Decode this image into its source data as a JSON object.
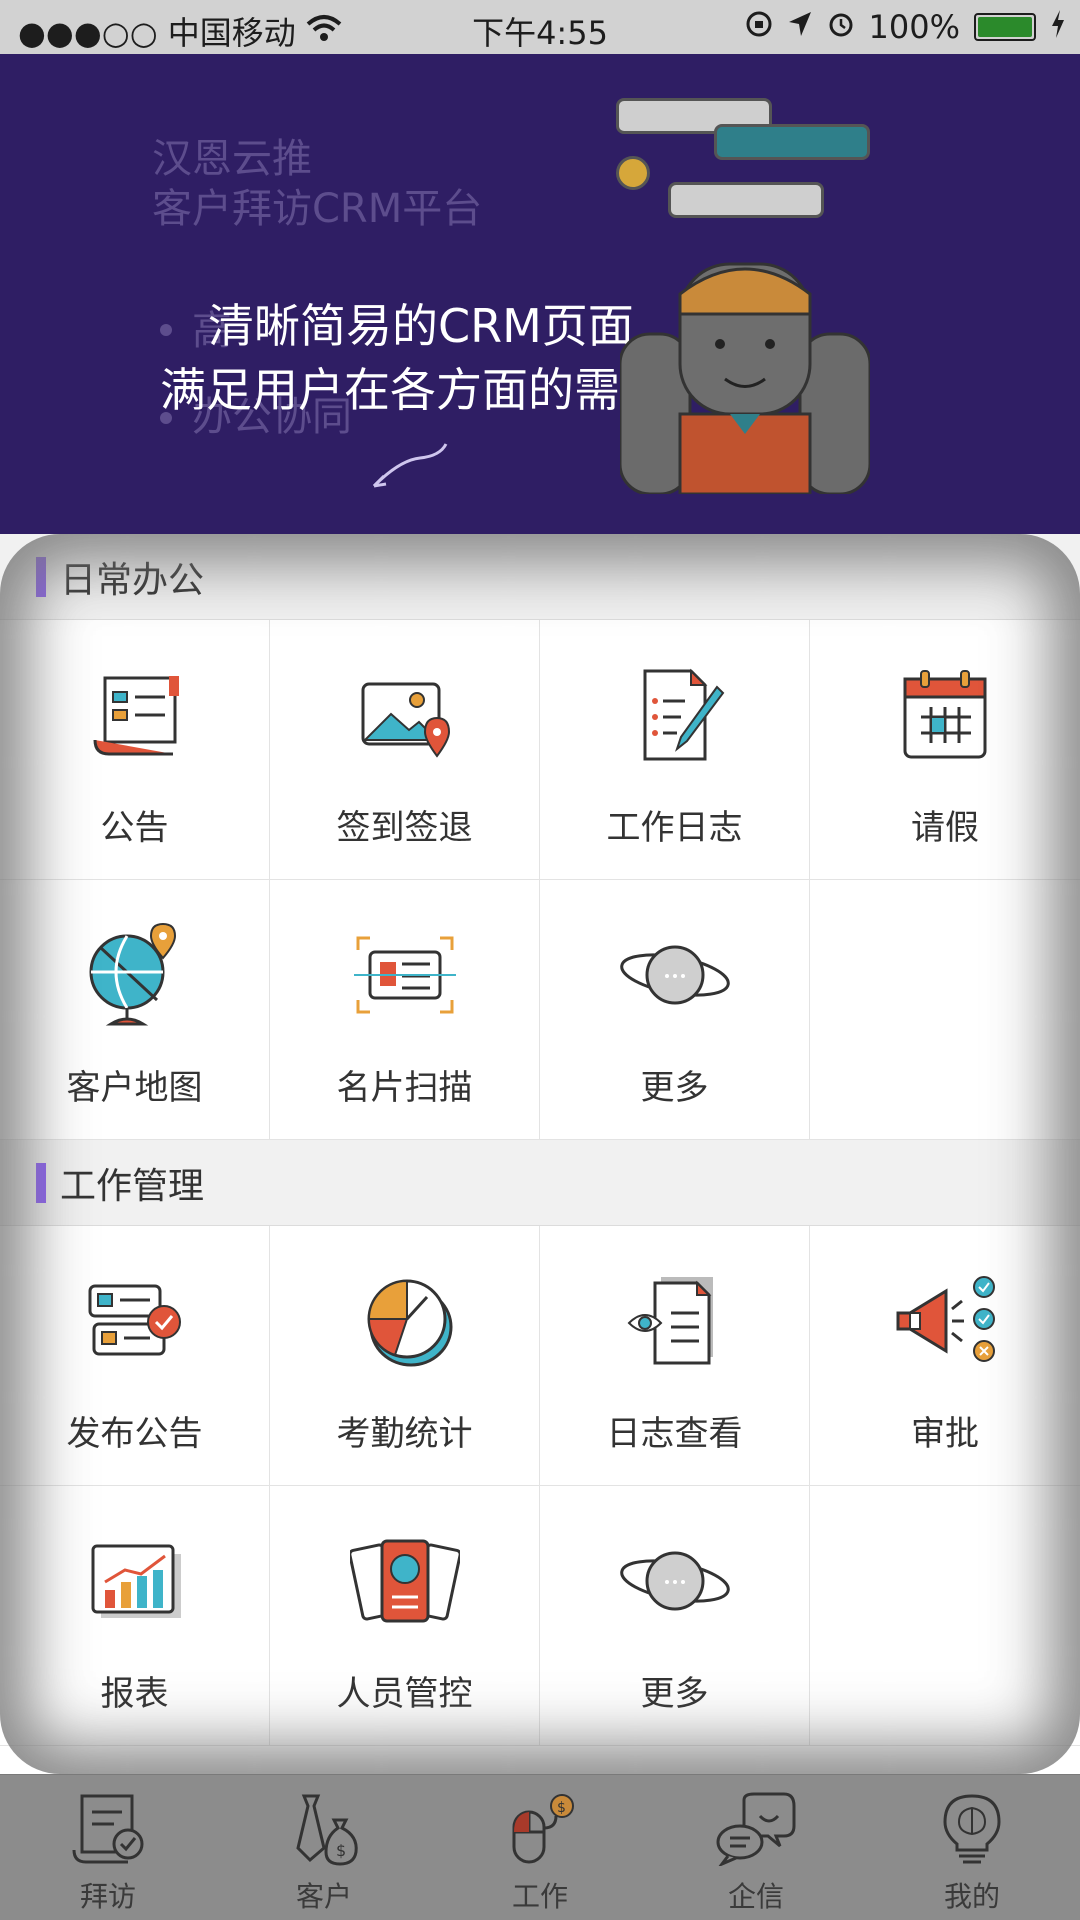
{
  "status_bar": {
    "carrier": "●●●○○ 中国移动",
    "time": "下午4:55",
    "battery": "100%"
  },
  "hero": {
    "faded_title_line1": "汉恩云推",
    "faded_title_line2": "客户拜访CRM平台",
    "faded_bullet1": "高",
    "faded_bullet2": "办公协同",
    "slogan_line1": "清晰简易的CRM页面,",
    "slogan_line2": "满足用户在各方面的需求"
  },
  "sections": [
    {
      "title": "日常办公",
      "items": [
        {
          "label": "公告",
          "icon": "notice-scroll-icon"
        },
        {
          "label": "签到签退",
          "icon": "map-pin-photo-icon"
        },
        {
          "label": "工作日志",
          "icon": "document-pen-icon"
        },
        {
          "label": "请假",
          "icon": "calendar-icon"
        },
        {
          "label": "客户地图",
          "icon": "globe-icon"
        },
        {
          "label": "名片扫描",
          "icon": "card-scan-icon"
        },
        {
          "label": "更多",
          "icon": "planet-icon"
        }
      ]
    },
    {
      "title": "工作管理",
      "items": [
        {
          "label": "发布公告",
          "icon": "publish-notice-icon"
        },
        {
          "label": "考勤统计",
          "icon": "clock-pie-icon"
        },
        {
          "label": "日志查看",
          "icon": "document-eye-icon"
        },
        {
          "label": "审批",
          "icon": "megaphone-check-icon"
        },
        {
          "label": "报表",
          "icon": "bar-chart-icon"
        },
        {
          "label": "人员管控",
          "icon": "person-cards-icon"
        },
        {
          "label": "更多",
          "icon": "planet-icon"
        }
      ]
    }
  ],
  "tabs": [
    {
      "label": "拜访",
      "icon": "visit-scroll-icon"
    },
    {
      "label": "客户",
      "icon": "tie-moneybag-icon"
    },
    {
      "label": "工作",
      "icon": "mouse-coin-icon"
    },
    {
      "label": "企信",
      "icon": "chat-bubbles-icon"
    },
    {
      "label": "我的",
      "icon": "lightbulb-brain-icon"
    }
  ],
  "colors": {
    "accent": "#8b5cf6",
    "hero_bg": "#2f1e64",
    "icon_red": "#e0553a",
    "icon_teal": "#3fb4c9"
  }
}
